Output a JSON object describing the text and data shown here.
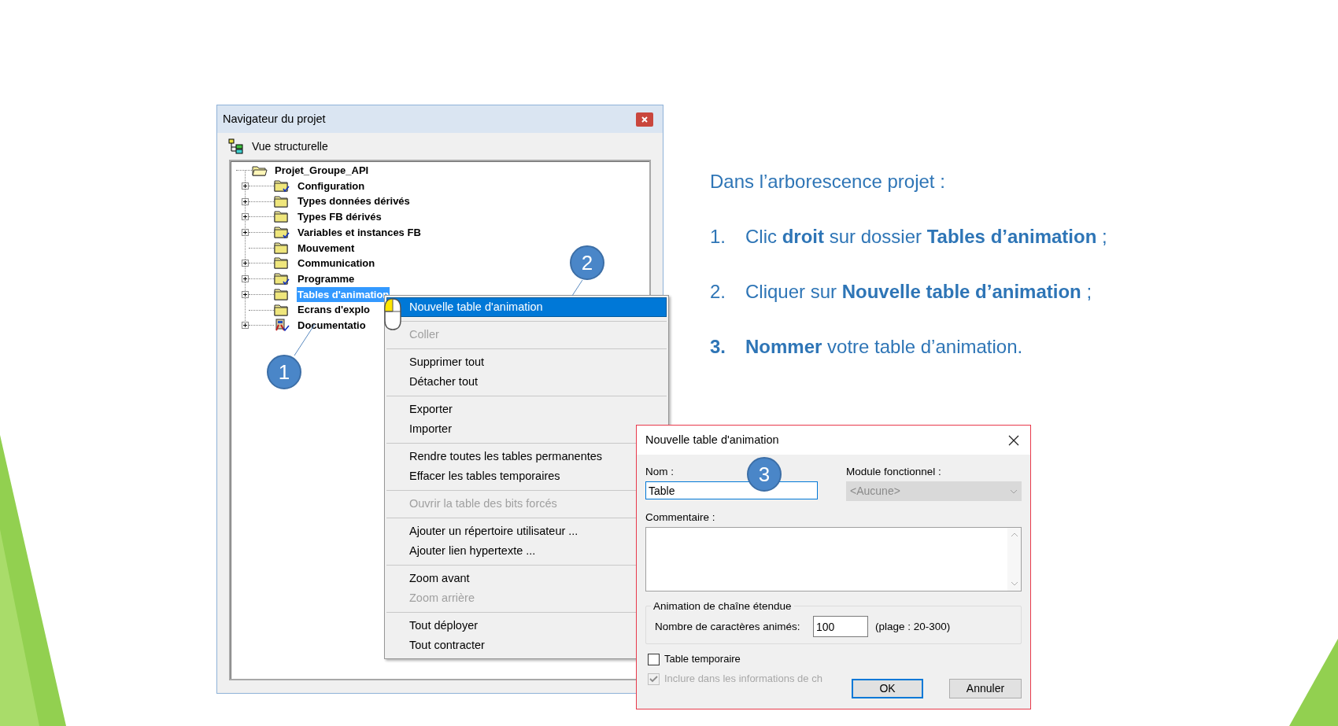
{
  "slide": {
    "intro": "Dans l’arborescence projet :",
    "steps": [
      {
        "number": "1.",
        "text": "Clic **droit** sur dossier **Tables d’animation** ;",
        "highlighted": false
      },
      {
        "number": "2.",
        "text": "Cliquer sur **Nouvelle table d’animation** ;",
        "highlighted": false
      },
      {
        "number": "3.",
        "text": "**Nommer** votre table d’animation.",
        "highlighted": true
      }
    ]
  },
  "navigator": {
    "title": "Navigateur du projet",
    "view_label": "Vue structurelle",
    "tree": {
      "label": "Projet_Groupe_API",
      "children": [
        {
          "label": "Configuration",
          "kind": "folder",
          "expandable": true,
          "checked": true,
          "selected": false
        },
        {
          "label": "Types données dérivés",
          "kind": "folder",
          "expandable": true,
          "checked": false,
          "selected": false
        },
        {
          "label": "Types FB dérivés",
          "kind": "folder",
          "expandable": true,
          "checked": false,
          "selected": false
        },
        {
          "label": "Variables et instances FB",
          "kind": "folder",
          "expandable": true,
          "checked": true,
          "selected": false
        },
        {
          "label": "Mouvement",
          "kind": "folder",
          "expandable": false,
          "checked": false,
          "selected": false
        },
        {
          "label": "Communication",
          "kind": "folder",
          "expandable": true,
          "checked": false,
          "selected": false
        },
        {
          "label": "Programme",
          "kind": "folder",
          "expandable": true,
          "checked": true,
          "selected": false
        },
        {
          "label": "Tables d'animation",
          "kind": "folder",
          "expandable": true,
          "checked": false,
          "selected": true
        },
        {
          "label": "Ecrans d'explo",
          "kind": "folder",
          "expandable": false,
          "checked": false,
          "selected": false
        },
        {
          "label": "Documentatio",
          "kind": "documentation",
          "expandable": true,
          "checked": true,
          "selected": false
        }
      ]
    }
  },
  "context_menu": {
    "groups": [
      [
        {
          "label": "Nouvelle table d'animation",
          "selected": true,
          "disabled": false
        }
      ],
      [
        {
          "label": "Coller",
          "selected": false,
          "disabled": true
        }
      ],
      [
        {
          "label": "Supprimer tout",
          "selected": false,
          "disabled": false
        },
        {
          "label": "Détacher tout",
          "selected": false,
          "disabled": false
        }
      ],
      [
        {
          "label": "Exporter",
          "selected": false,
          "disabled": false
        },
        {
          "label": "Importer",
          "selected": false,
          "disabled": false
        }
      ],
      [
        {
          "label": "Rendre toutes les tables permanentes",
          "selected": false,
          "disabled": false
        },
        {
          "label": "Effacer les tables temporaires",
          "selected": false,
          "disabled": false
        }
      ],
      [
        {
          "label": "Ouvrir la table des bits forcés",
          "selected": false,
          "disabled": true
        }
      ],
      [
        {
          "label": "Ajouter un répertoire utilisateur ...",
          "selected": false,
          "disabled": false
        },
        {
          "label": "Ajouter lien hypertexte ...",
          "selected": false,
          "disabled": false
        }
      ],
      [
        {
          "label": "Zoom avant",
          "selected": false,
          "disabled": false
        },
        {
          "label": "Zoom arrière",
          "selected": false,
          "disabled": true
        }
      ],
      [
        {
          "label": "Tout déployer",
          "selected": false,
          "disabled": false
        },
        {
          "label": "Tout contracter",
          "selected": false,
          "disabled": false
        }
      ]
    ]
  },
  "dialog": {
    "title": "Nouvelle table d'animation",
    "name_label": "Nom :",
    "name_value": "Table",
    "module_label": "Module fonctionnel :",
    "module": {
      "value": "<Aucune>",
      "disabled": true
    },
    "comment_label": "Commentaire :",
    "group_title": "Animation de chaîne étendue",
    "count_label": "Nombre de caractères animés:",
    "count_value": "100",
    "range": "(plage : 20-300)",
    "checkboxes": [
      {
        "label": "Table temporaire",
        "checked": false,
        "disabled": false
      },
      {
        "label": "Inclure dans les informations de ch",
        "checked": true,
        "disabled": true
      }
    ],
    "buttons": [
      {
        "label": "OK",
        "default": true
      },
      {
        "label": "Annuler",
        "default": false
      }
    ]
  },
  "callouts": [
    {
      "number": "1"
    },
    {
      "number": "2"
    },
    {
      "number": "3"
    }
  ]
}
